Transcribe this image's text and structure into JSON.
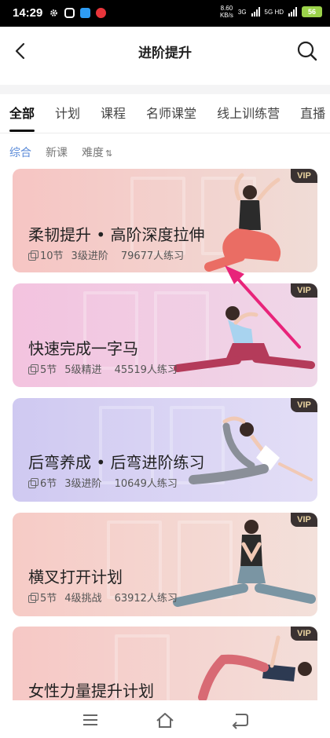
{
  "status_bar": {
    "time": "14:29",
    "net_speed_value": "8.60",
    "net_speed_unit": "KB/s",
    "net1": "3G",
    "net2": "5G HD",
    "battery": "56"
  },
  "header": {
    "title": "进阶提升"
  },
  "tabs": [
    "全部",
    "计划",
    "课程",
    "名师课堂",
    "线上训练营",
    "直播"
  ],
  "filters": {
    "items": [
      "综合",
      "新课",
      "难度"
    ],
    "sort_symbol": "⇅"
  },
  "cards": [
    {
      "title": "柔韧提升 • 高阶深度拉伸",
      "lessons": "10节",
      "level": "3级进阶",
      "practitioners": "79677人练习",
      "badge": "VIP",
      "color_from": "#f6c5c3",
      "color_to": "#f0dcd6"
    },
    {
      "title": "快速完成一字马",
      "lessons": "5节",
      "level": "5级精进",
      "practitioners": "45519人练习",
      "badge": "VIP",
      "color_from": "#f3c3df",
      "color_to": "#efd7e8"
    },
    {
      "title": "后弯养成 • 后弯进阶练习",
      "lessons": "6节",
      "level": "3级进阶",
      "practitioners": "10649人练习",
      "badge": "VIP",
      "color_from": "#cfc9f1",
      "color_to": "#e3def6"
    },
    {
      "title": "横叉打开计划",
      "lessons": "5节",
      "level": "4级挑战",
      "practitioners": "63912人练习",
      "badge": "VIP",
      "color_from": "#f6cbc6",
      "color_to": "#f3e0da"
    },
    {
      "title": "女性力量提升计划",
      "badge": "VIP",
      "color_from": "#f6c8c5",
      "color_to": "#f3ded9"
    }
  ],
  "annotation": {
    "arrow_color": "#e8247a"
  },
  "icons": [
    "back-arrow-icon",
    "search-icon",
    "menu-icon",
    "home-icon",
    "return-icon"
  ]
}
